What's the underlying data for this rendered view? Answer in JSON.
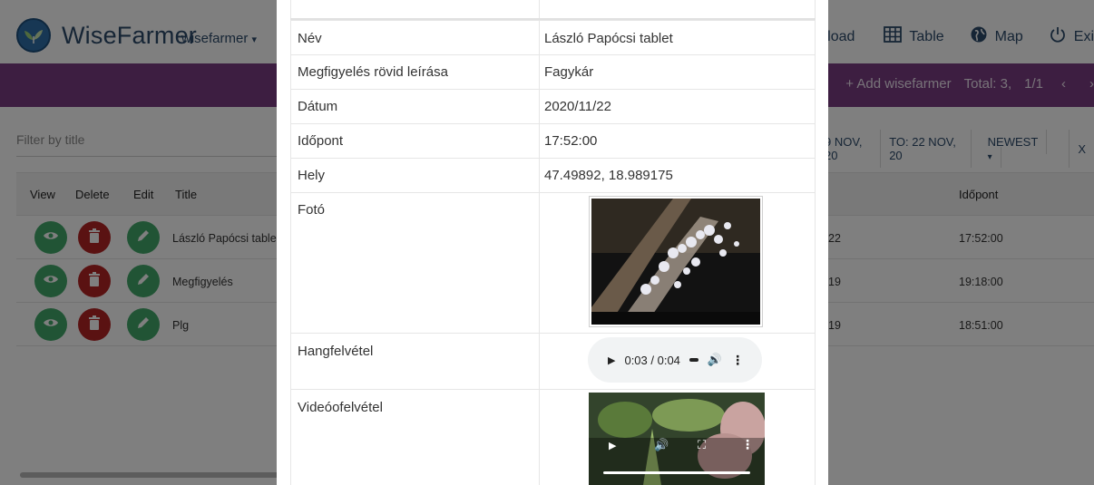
{
  "navbar": {
    "brand": "WiseFarmer",
    "user_menu": "wisefarmer",
    "download_label": "nload",
    "table_label": "Table",
    "map_label": "Map",
    "exit_label": "Exi"
  },
  "toolbar": {
    "add_label": "+ Add wisefarmer",
    "total_label": "Total: 3,",
    "page_label": "1/1",
    "prev_icon": "chevron-left-icon",
    "next_icon": "chevron-right-icon"
  },
  "filter": {
    "placeholder": "Filter by title"
  },
  "date_controls": {
    "from_label": "9 NOV, 20",
    "to_label": "TO: 22 NOV, 20",
    "sort_label": "NEWEST",
    "close_label": "X"
  },
  "table": {
    "headers": {
      "view": "View",
      "delete": "Delete",
      "edit": "Edit",
      "title": "Title",
      "date": "",
      "time": "Időpont"
    },
    "rows": [
      {
        "title": "László Papócsi table",
        "date": "22",
        "time": "17:52:00"
      },
      {
        "title": "Megfigyelés",
        "date": "19",
        "time": "19:18:00"
      },
      {
        "title": "Plg",
        "date": "19",
        "time": "18:51:00"
      }
    ]
  },
  "modal": {
    "fields": [
      {
        "label": "Név",
        "value": "László Papócsi tablet"
      },
      {
        "label": "Megfigyelés rövid leírása",
        "value": "Fagykár"
      },
      {
        "label": "Dátum",
        "value": "2020/11/22"
      },
      {
        "label": "Időpont",
        "value": "17:52:00"
      },
      {
        "label": "Hely",
        "value": "47.49892, 18.989175"
      }
    ],
    "photo_label": "Fotó",
    "audio_label": "Hangfelvétel",
    "audio_time": "0:03 / 0:04",
    "video_label": "Videóofelvétel"
  },
  "colors": {
    "purple_bar": "#7a3c83",
    "view_button": "#43a86a",
    "delete_button": "#b52424",
    "brand_text": "#2c4a6b"
  }
}
